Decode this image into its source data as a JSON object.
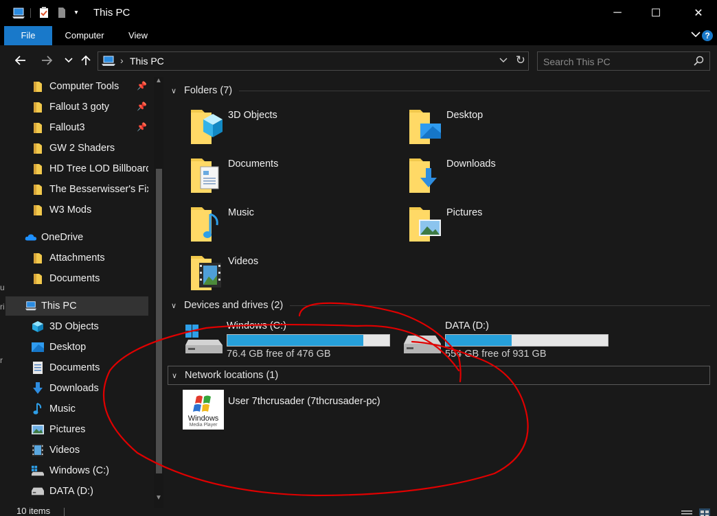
{
  "window": {
    "title": "This PC",
    "controls": {
      "minimize": "─",
      "maximize": "☐",
      "close": "✕"
    }
  },
  "ribbon": {
    "tabs": [
      {
        "label": "File",
        "active": true
      },
      {
        "label": "Computer",
        "active": false
      },
      {
        "label": "View",
        "active": false
      }
    ],
    "help": "?"
  },
  "address": {
    "path": "This PC"
  },
  "search": {
    "placeholder": "Search This PC"
  },
  "nav": {
    "quick_access": [
      {
        "label": "Computer Tools",
        "pinned": true
      },
      {
        "label": "Fallout 3 goty",
        "pinned": true
      },
      {
        "label": "Fallout3",
        "pinned": true
      },
      {
        "label": "GW 2 Shaders",
        "pinned": false
      },
      {
        "label": "HD Tree LOD Billboards",
        "pinned": false
      },
      {
        "label": "The Besserwisser's Fix",
        "pinned": false
      },
      {
        "label": "W3 Mods",
        "pinned": false
      }
    ],
    "onedrive": {
      "label": "OneDrive",
      "children": [
        "Attachments",
        "Documents"
      ]
    },
    "this_pc": {
      "label": "This PC",
      "children": [
        {
          "label": "3D Objects",
          "icon": "3d-objects-icon"
        },
        {
          "label": "Desktop",
          "icon": "desktop-icon"
        },
        {
          "label": "Documents",
          "icon": "documents-icon"
        },
        {
          "label": "Downloads",
          "icon": "downloads-icon"
        },
        {
          "label": "Music",
          "icon": "music-icon"
        },
        {
          "label": "Pictures",
          "icon": "pictures-icon"
        },
        {
          "label": "Videos",
          "icon": "videos-icon"
        },
        {
          "label": "Windows (C:)",
          "icon": "windows-drive-icon"
        },
        {
          "label": "DATA (D:)",
          "icon": "drive-icon"
        }
      ]
    }
  },
  "content": {
    "folders": {
      "header": "Folders (7)",
      "items": [
        "3D Objects",
        "Desktop",
        "Documents",
        "Downloads",
        "Music",
        "Pictures",
        "Videos"
      ]
    },
    "drives": {
      "header": "Devices and drives (2)",
      "items": [
        {
          "name": "Windows (C:)",
          "free_text": "76.4 GB free of 476 GB",
          "used_fraction": 0.84
        },
        {
          "name": "DATA (D:)",
          "free_text": "554 GB free of 931 GB",
          "used_fraction": 0.405
        }
      ]
    },
    "network": {
      "header": "Network locations (1)",
      "items": [
        {
          "name": "User 7thcrusader (7thcrusader-pc)",
          "thumb_text_1": "Windows",
          "thumb_text_2": "Media Player"
        }
      ]
    }
  },
  "status": {
    "count": "10 items"
  },
  "colors": {
    "accent": "#1979ca",
    "drive_bar": "#26a0da",
    "annotation": "#e00000",
    "folder": "#f2c94c"
  }
}
